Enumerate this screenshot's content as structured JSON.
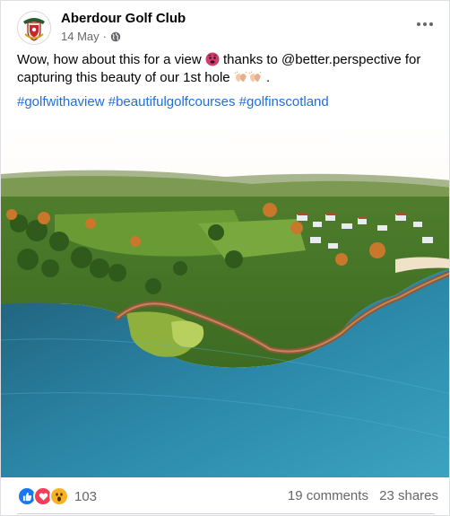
{
  "post": {
    "page_name": "Aberdour Golf Club",
    "date": "14 May",
    "separator": "·",
    "privacy_icon": "globe-icon",
    "more_icon": "more-options-icon",
    "text_part1": "Wow, how about this for a view ",
    "text_part2": " thanks to @better.perspective for capturing this beauty of our 1st hole ",
    "text_part3": " .",
    "emoji_1": "hot-face-emoji",
    "emoji_2": "clapping-hands-emoji",
    "hashtags": [
      "#golfwithaview",
      "#beautifulgolfcourses",
      "#golfinscotland"
    ],
    "image": "aerial-golf-course-photo"
  },
  "footer": {
    "reaction_icons": [
      "like-icon",
      "love-icon",
      "wow-icon"
    ],
    "reaction_count": "103",
    "comments": "19 comments",
    "shares": "23 shares"
  },
  "colors": {
    "link": "#216fdb",
    "like": "#1877f2",
    "love": "#f33e58",
    "wow": "#f7b125",
    "secondary_text": "#65676b"
  }
}
